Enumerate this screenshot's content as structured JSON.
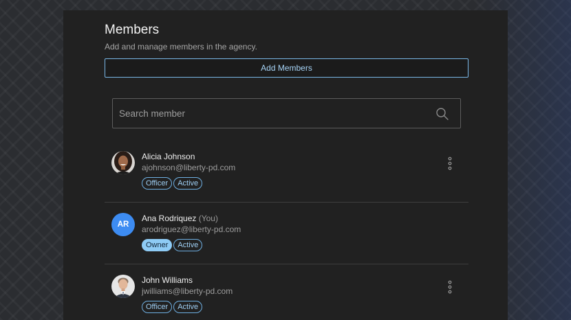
{
  "header": {
    "title": "Members",
    "subtitle": "Add and manage members in the agency.",
    "add_button_label": "Add Members"
  },
  "search": {
    "placeholder": "Search member",
    "value": ""
  },
  "members": [
    {
      "name": "Alicia Johnson",
      "you_label": "",
      "email": "ajohnson@liberty-pd.com",
      "role": "Officer",
      "status": "Active",
      "avatar": "photo",
      "has_menu": true
    },
    {
      "name": "Ana Rodriquez",
      "you_label": "(You)",
      "email": "arodriguez@liberty-pd.com",
      "initials": "AR",
      "role": "Owner",
      "status": "Active",
      "avatar": "initials",
      "has_menu": false
    },
    {
      "name": "John Williams",
      "you_label": "",
      "email": "jwilliams@liberty-pd.com",
      "role": "Officer",
      "status": "Active",
      "avatar": "photo",
      "has_menu": true
    }
  ],
  "icons": {
    "search": "search-icon",
    "more": "more-vertical-icon"
  },
  "colors": {
    "accent": "#7ab8e8",
    "avatar_initials_bg": "#3d8cf2",
    "owner_badge_bg": "#8ecbf5",
    "panel_bg": "#212121"
  }
}
